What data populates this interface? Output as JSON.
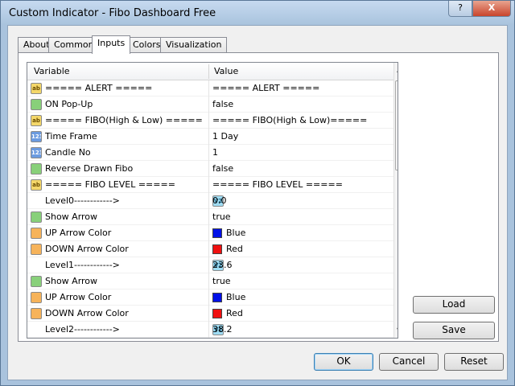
{
  "window": {
    "title": "Custom Indicator - Fibo Dashboard Free",
    "help_label": "?",
    "close_label": "X"
  },
  "tabs": [
    {
      "label": "About"
    },
    {
      "label": "Common"
    },
    {
      "label": "Inputs",
      "active": true
    },
    {
      "label": "Colors"
    },
    {
      "label": "Visualization"
    }
  ],
  "grid": {
    "col_variable": "Variable",
    "col_value": "Value",
    "rows": [
      {
        "icon": "string-icon",
        "icon_text": "ab",
        "variable": "===== ALERT =====",
        "value": "===== ALERT ====="
      },
      {
        "icon": "bool-icon",
        "icon_text": "",
        "variable": "ON Pop-Up",
        "value": "false"
      },
      {
        "icon": "string-icon",
        "icon_text": "ab",
        "variable": "===== FIBO(High & Low) =====",
        "value": "===== FIBO(High & Low)====="
      },
      {
        "icon": "int-icon",
        "icon_text": "123",
        "variable": "Time Frame",
        "value": "1 Day"
      },
      {
        "icon": "int-icon",
        "icon_text": "123",
        "variable": "Candle No",
        "value": "1"
      },
      {
        "icon": "bool-icon",
        "icon_text": "",
        "variable": "Reverse Drawn Fibo",
        "value": "false"
      },
      {
        "icon": "string-icon",
        "icon_text": "ab",
        "variable": "===== FIBO LEVEL =====",
        "value": "===== FIBO LEVEL ====="
      },
      {
        "icon": "double-icon",
        "icon_text": "V2",
        "variable": "Level0------------>",
        "value": "0.0"
      },
      {
        "icon": "bool-icon",
        "icon_text": "",
        "variable": "Show Arrow",
        "value": "true"
      },
      {
        "icon": "color-icon",
        "icon_text": "",
        "variable": "UP Arrow Color",
        "value": "Blue",
        "swatch": "#0010e8"
      },
      {
        "icon": "color-icon",
        "icon_text": "",
        "variable": "DOWN Arrow Color",
        "value": "Red",
        "swatch": "#f01010"
      },
      {
        "icon": "double-icon",
        "icon_text": "V2",
        "variable": "Level1------------>",
        "value": "23.6"
      },
      {
        "icon": "bool-icon",
        "icon_text": "",
        "variable": "Show Arrow",
        "value": "true"
      },
      {
        "icon": "color-icon",
        "icon_text": "",
        "variable": "UP Arrow Color",
        "value": "Blue",
        "swatch": "#0010e8"
      },
      {
        "icon": "color-icon",
        "icon_text": "",
        "variable": "DOWN Arrow Color",
        "value": "Red",
        "swatch": "#f01010"
      },
      {
        "icon": "double-icon",
        "icon_text": "V2",
        "variable": "Level2------------>",
        "value": "38.2"
      }
    ]
  },
  "side_buttons": {
    "load_label": "Load",
    "save_label": "Save"
  },
  "footer_buttons": {
    "ok_label": "OK",
    "cancel_label": "Cancel",
    "reset_label": "Reset"
  }
}
